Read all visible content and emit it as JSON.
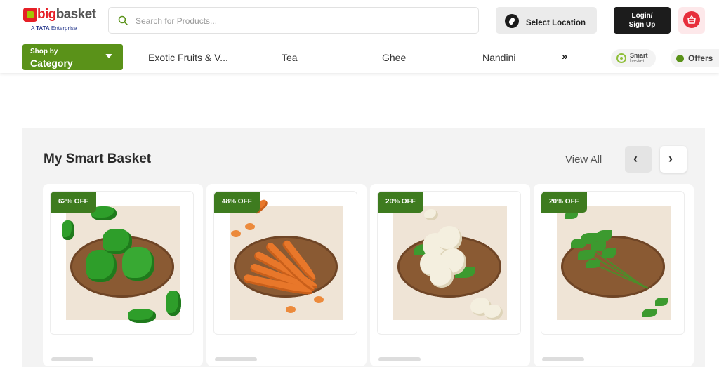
{
  "brand": {
    "logo_big": "big",
    "logo_basket": "basket",
    "tagline_prefix": "A",
    "tagline_brand": "TATA",
    "tagline_suffix": "Enterprise"
  },
  "search": {
    "placeholder": "Search for Products..."
  },
  "header": {
    "select_location": "Select Location",
    "login_line1": "Login/",
    "login_line2": "Sign Up"
  },
  "category_button": {
    "small": "Shop by",
    "big": "Category"
  },
  "nav": {
    "items": [
      "Exotic Fruits & V...",
      "Tea",
      "Ghee",
      "Nandini"
    ],
    "more": "»"
  },
  "smart_basket_pill": {
    "line1": "Smart",
    "line2": "basket"
  },
  "offers_pill": {
    "label": "Offers"
  },
  "section": {
    "title": "My Smart Basket",
    "view_all": "View All",
    "prev": "‹",
    "next": "›"
  },
  "products": [
    {
      "discount": "62% OFF",
      "image": "green-capsicum"
    },
    {
      "discount": "48% OFF",
      "image": "carrots"
    },
    {
      "discount": "20% OFF",
      "image": "cauliflower"
    },
    {
      "discount": "20% OFF",
      "image": "coriander"
    }
  ],
  "colors": {
    "brand_red": "#e61f26",
    "brand_green": "#5a9219",
    "badge_green": "#3e7b1f",
    "dark_button": "#1c1c1c"
  }
}
